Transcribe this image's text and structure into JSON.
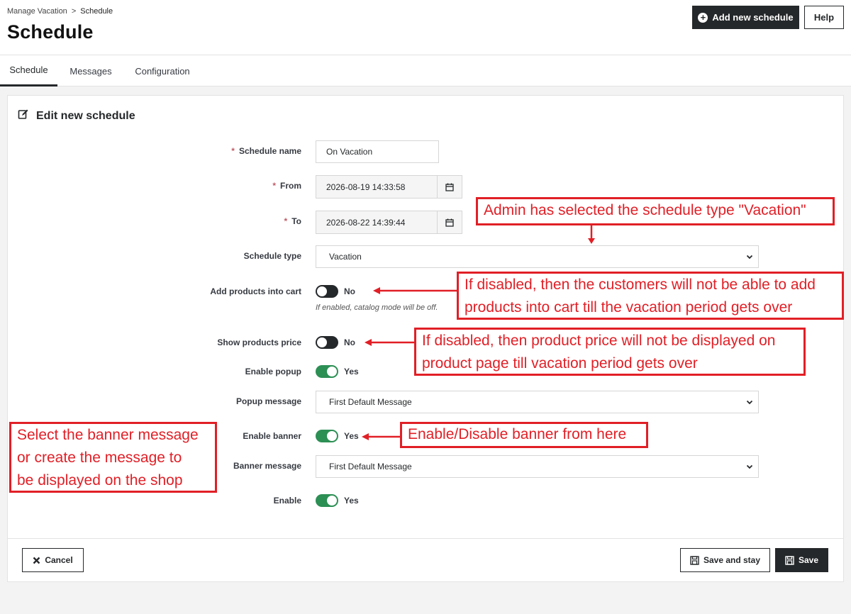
{
  "breadcrumb": {
    "parent": "Manage Vacation",
    "separator": ">",
    "current": "Schedule"
  },
  "page_title": "Schedule",
  "header_buttons": {
    "add_new": "Add new schedule",
    "help": "Help"
  },
  "tabs": [
    {
      "label": "Schedule",
      "active": true
    },
    {
      "label": "Messages",
      "active": false
    },
    {
      "label": "Configuration",
      "active": false
    }
  ],
  "form": {
    "title": "Edit new schedule",
    "required_marker": "*",
    "schedule_name": {
      "label": "Schedule name",
      "value": "On Vacation"
    },
    "from": {
      "label": "From",
      "value": "2026-08-19 14:33:58"
    },
    "to": {
      "label": "To",
      "value": "2026-08-22 14:39:44"
    },
    "schedule_type": {
      "label": "Schedule type",
      "value": "Vacation"
    },
    "add_products": {
      "label": "Add products into cart",
      "state": "No",
      "help": "If enabled, catalog mode will be off."
    },
    "show_price": {
      "label": "Show products price",
      "state": "No"
    },
    "enable_popup": {
      "label": "Enable popup",
      "state": "Yes"
    },
    "popup_message": {
      "label": "Popup message",
      "value": "First Default Message"
    },
    "enable_banner": {
      "label": "Enable banner",
      "state": "Yes"
    },
    "banner_message": {
      "label": "Banner message",
      "value": "First Default Message"
    },
    "enable": {
      "label": "Enable",
      "state": "Yes"
    }
  },
  "footer_buttons": {
    "cancel": "Cancel",
    "save_and_stay": "Save and stay",
    "save": "Save"
  },
  "annotations": {
    "schedule_type": "Admin has selected the schedule type \"Vacation\"",
    "add_products_line1": "If disabled, then the customers will not be able to add",
    "add_products_line2": "products into cart till the vacation period gets over",
    "show_price_line1": "If disabled, then product price will not be displayed on",
    "show_price_line2": "product page till vacation period gets over",
    "banner_toggle": "Enable/Disable banner from here",
    "banner_message_line1": "Select the banner message",
    "banner_message_line2": "or create the message to",
    "banner_message_line3": "be displayed on the shop"
  },
  "colors": {
    "dark": "#25282a",
    "toggle_on": "#2c8f54",
    "annotation_red": "#e11f26",
    "required": "#c05c67"
  }
}
